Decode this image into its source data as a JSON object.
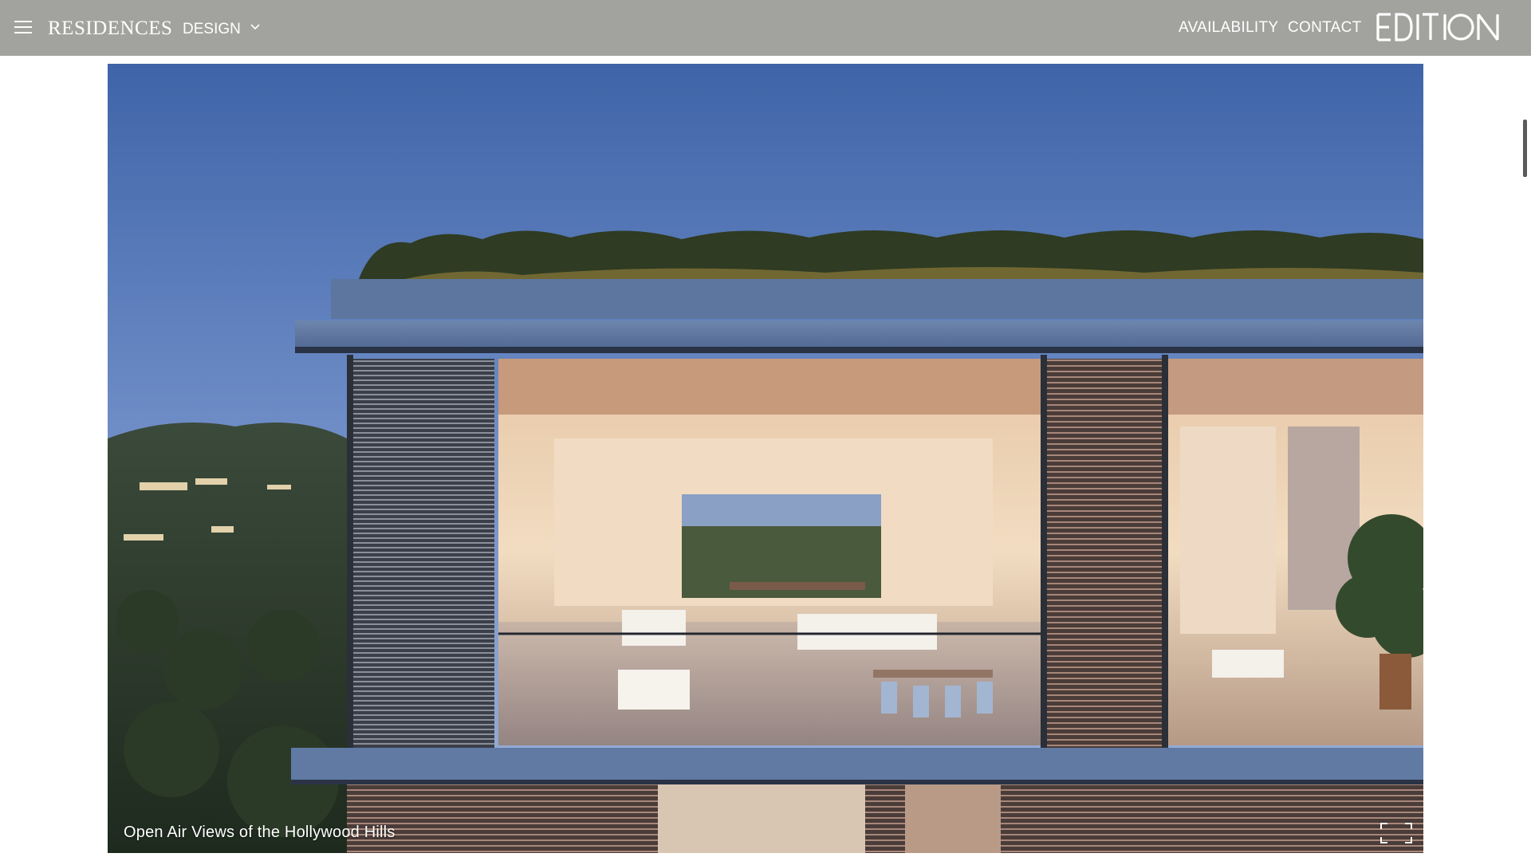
{
  "header": {
    "brand": "RESIDENCES",
    "design_label": "DESIGN",
    "nav": [
      "AVAILABILITY",
      "CONTACT"
    ],
    "logo_text": "EDITION",
    "menu_icon": "hamburger-icon",
    "dropdown_icon": "chevron-down-icon",
    "background_color": "#a2a39e"
  },
  "hero": {
    "caption": "Open Air Views of the Hollywood Hills",
    "fullscreen_icon": "fullscreen-icon"
  }
}
